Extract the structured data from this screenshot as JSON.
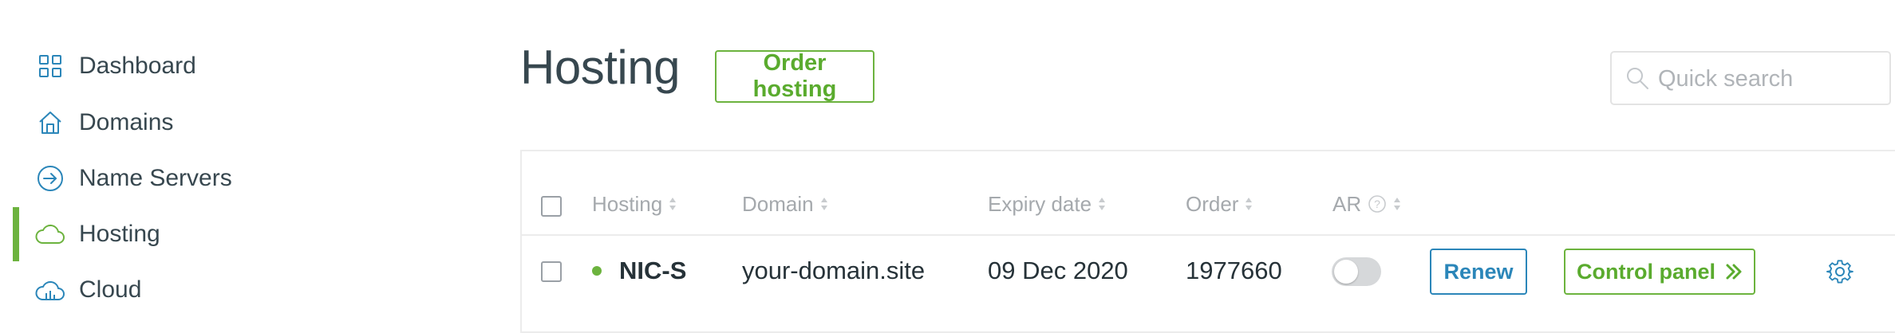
{
  "sidebar": {
    "items": [
      {
        "label": "Dashboard",
        "icon": "dashboard-grid-icon",
        "active": false
      },
      {
        "label": "Domains",
        "icon": "house-icon",
        "active": false
      },
      {
        "label": "Name Servers",
        "icon": "circle-arrow-right-icon",
        "active": false
      },
      {
        "label": "Hosting",
        "icon": "cloud-icon",
        "active": true
      },
      {
        "label": "Cloud",
        "icon": "cloud-bars-icon",
        "active": false
      }
    ]
  },
  "header": {
    "title": "Hosting",
    "order_button": "Order hosting",
    "search": {
      "placeholder": "Quick search",
      "value": ""
    }
  },
  "table": {
    "columns": [
      "Hosting",
      "Domain",
      "Expiry date",
      "Order",
      "AR"
    ],
    "rows": [
      {
        "status": "active",
        "hosting": "NIC-S",
        "domain": "your-domain.site",
        "expiry_date": "09 Dec 2020",
        "order": "1977660",
        "ar_enabled": false,
        "renew_label": "Renew",
        "control_panel_label": "Control panel"
      }
    ]
  },
  "colors": {
    "accent_green": "#6cb33e",
    "accent_blue": "#2b86b9",
    "text": "#37474f",
    "muted": "#a5a9ad",
    "border": "#ececec"
  }
}
